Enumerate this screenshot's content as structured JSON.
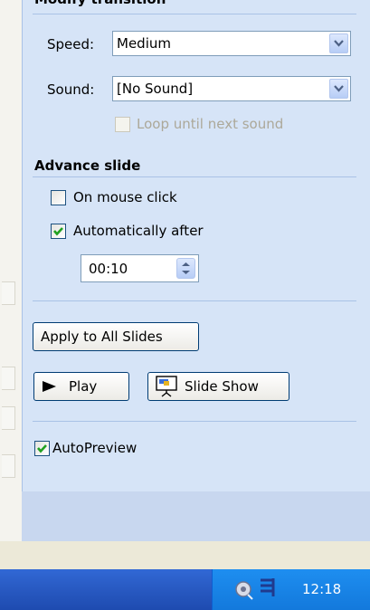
{
  "section_modify": {
    "title": "Modify transition"
  },
  "speed": {
    "label": "Speed:",
    "value": "Medium"
  },
  "sound": {
    "label": "Sound:",
    "value": "[No Sound]"
  },
  "loop": {
    "label": "Loop until next sound",
    "checked": false,
    "enabled": false
  },
  "advance": {
    "title": "Advance slide",
    "on_click": {
      "label": "On mouse click",
      "checked": false
    },
    "auto": {
      "label": "Automatically after",
      "checked": true
    },
    "time": "00:10"
  },
  "buttons": {
    "apply_all": "Apply to All Slides",
    "play": "Play",
    "slide_show": "Slide Show"
  },
  "autopreview": {
    "label": "AutoPreview",
    "checked": true
  },
  "taskbar": {
    "clock": "12:18"
  },
  "icons": [
    "chevron-down-icon",
    "spinner-icon",
    "play-icon",
    "slide-show-icon",
    "checkmark-icon",
    "speaker-icon",
    "network-icon"
  ],
  "colors": {
    "pane": "#D6E4F7",
    "check": "#21A121",
    "taskbar": "#2A5CC5",
    "tray": "#1379DC"
  }
}
